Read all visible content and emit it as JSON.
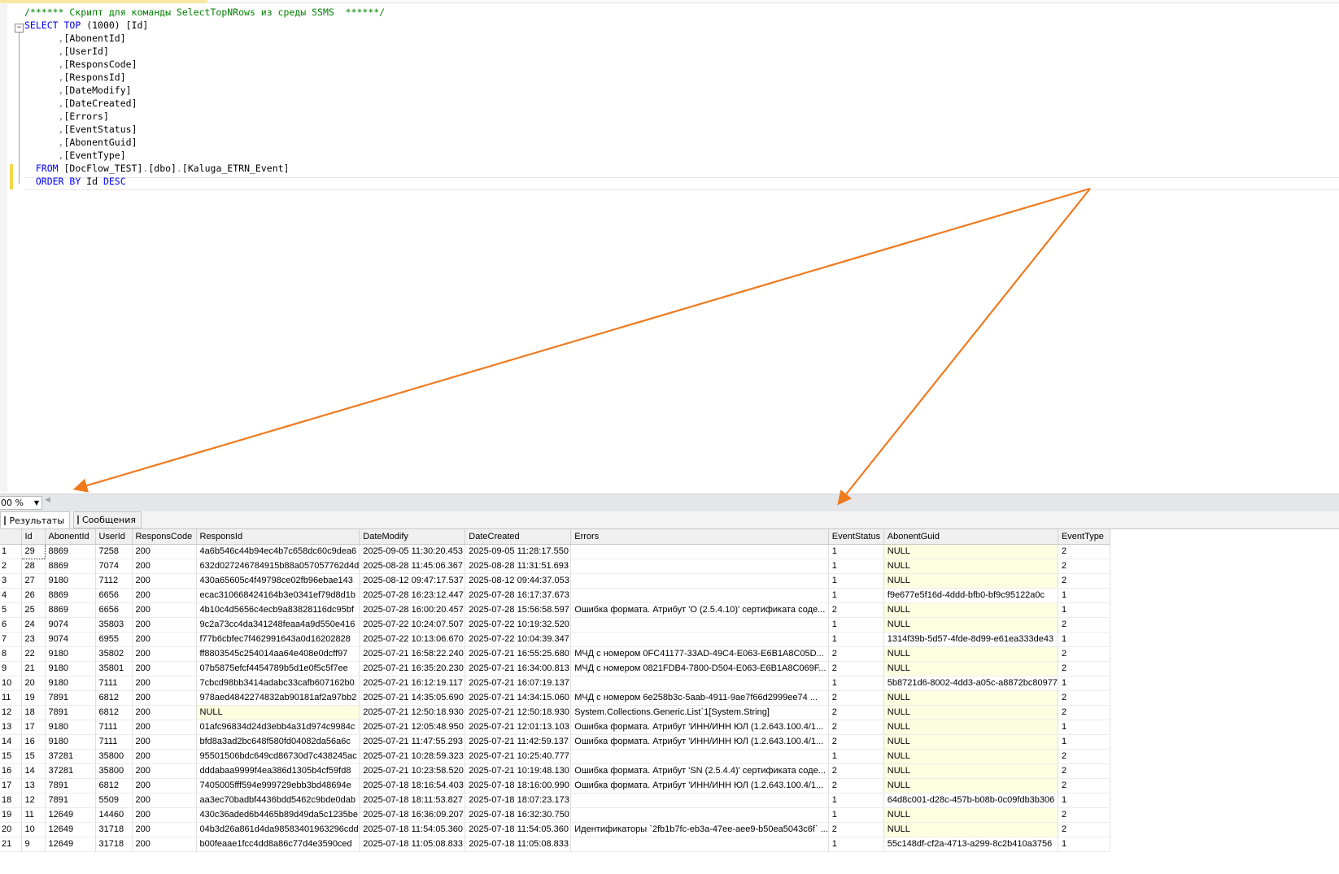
{
  "editor": {
    "lines": [
      [
        {
          "t": "/****** Скрипт для команды SelectTopNRows из среды SSMS  ******/",
          "c": "cm"
        }
      ],
      [
        {
          "t": "SELECT",
          "c": "kw"
        },
        {
          "t": " "
        },
        {
          "t": "TOP",
          "c": "kw"
        },
        {
          "t": " (1000) [Id]"
        }
      ],
      [
        {
          "t": "      "
        },
        {
          "t": ",",
          "c": "gr"
        },
        {
          "t": "[AbonentId]"
        }
      ],
      [
        {
          "t": "      "
        },
        {
          "t": ",",
          "c": "gr"
        },
        {
          "t": "[UserId]"
        }
      ],
      [
        {
          "t": "      "
        },
        {
          "t": ",",
          "c": "gr"
        },
        {
          "t": "[ResponsCode]"
        }
      ],
      [
        {
          "t": "      "
        },
        {
          "t": ",",
          "c": "gr"
        },
        {
          "t": "[ResponsId]"
        }
      ],
      [
        {
          "t": "      "
        },
        {
          "t": ",",
          "c": "gr"
        },
        {
          "t": "[DateModify]"
        }
      ],
      [
        {
          "t": "      "
        },
        {
          "t": ",",
          "c": "gr"
        },
        {
          "t": "[DateCreated]"
        }
      ],
      [
        {
          "t": "      "
        },
        {
          "t": ",",
          "c": "gr"
        },
        {
          "t": "[Errors]"
        }
      ],
      [
        {
          "t": "      "
        },
        {
          "t": ",",
          "c": "gr"
        },
        {
          "t": "[EventStatus]"
        }
      ],
      [
        {
          "t": "      "
        },
        {
          "t": ",",
          "c": "gr"
        },
        {
          "t": "[AbonentGuid]"
        }
      ],
      [
        {
          "t": "      "
        },
        {
          "t": ",",
          "c": "gr"
        },
        {
          "t": "[EventType]"
        }
      ],
      [
        {
          "t": "  "
        },
        {
          "t": "FROM",
          "c": "kw"
        },
        {
          "t": " [DocFlow_TEST]"
        },
        {
          "t": ".",
          "c": "gr"
        },
        {
          "t": "[dbo]"
        },
        {
          "t": ".",
          "c": "gr"
        },
        {
          "t": "[Kaluga_ETRN_Event]"
        }
      ],
      [
        {
          "t": "  "
        },
        {
          "t": "ORDER BY",
          "c": "kw"
        },
        {
          "t": " Id "
        },
        {
          "t": "DESC",
          "c": "kw"
        }
      ]
    ],
    "fold_symbol": "−"
  },
  "zoom": {
    "value": "00 %",
    "dropdown_icon": "▼",
    "scroll_left_icon": "◀"
  },
  "tabs": {
    "results": "Результаты",
    "messages": "Сообщения"
  },
  "grid": {
    "columns": [
      "Id",
      "AbonentId",
      "UserId",
      "ResponsCode",
      "ResponsId",
      "DateModify",
      "DateCreated",
      "Errors",
      "EventStatus",
      "AbonentGuid",
      "EventType"
    ],
    "rows": [
      [
        "1",
        "29",
        "8869",
        "7258",
        "200",
        "4a6b546c44b94ec4b7c658dc60c9dea6",
        "2025-09-05 11:30:20.453",
        "2025-09-05 11:28:17.550",
        "",
        "1",
        "NULL",
        "2"
      ],
      [
        "2",
        "28",
        "8869",
        "7074",
        "200",
        "632d027246784915b88a057057762d4d",
        "2025-08-28 11:45:06.367",
        "2025-08-28 11:31:51.693",
        "",
        "1",
        "NULL",
        "2"
      ],
      [
        "3",
        "27",
        "9180",
        "7112",
        "200",
        "430a65605c4f49798ce02fb96ebae143",
        "2025-08-12 09:47:17.537",
        "2025-08-12 09:44:37.053",
        "",
        "1",
        "NULL",
        "2"
      ],
      [
        "4",
        "26",
        "8869",
        "6656",
        "200",
        "ecac310668424164b3e0341ef79d8d1b",
        "2025-07-28 16:23:12.447",
        "2025-07-28 16:17:37.673",
        "",
        "1",
        "f9e677e5f16d-4ddd-bfb0-bf9c95122a0c",
        "1"
      ],
      [
        "5",
        "25",
        "8869",
        "6656",
        "200",
        "4b10c4d5656c4ecb9a83828116dc95bf",
        "2025-07-28 16:00:20.457",
        "2025-07-28 15:56:58.597",
        "Ошибка формата. Атрибут 'O (2.5.4.10)' сертификата соде...",
        "2",
        "NULL",
        "1"
      ],
      [
        "6",
        "24",
        "9074",
        "35803",
        "200",
        "9c2a73cc4da341248feaa4a9d550e416",
        "2025-07-22 10:24:07.507",
        "2025-07-22 10:19:32.520",
        "",
        "1",
        "NULL",
        "2"
      ],
      [
        "7",
        "23",
        "9074",
        "6955",
        "200",
        "f77b6cbfec7f462991643a0d16202828",
        "2025-07-22 10:13:06.670",
        "2025-07-22 10:04:39.347",
        "",
        "1",
        "1314f39b-5d57-4fde-8d99-e61ea333de43",
        "1"
      ],
      [
        "8",
        "22",
        "9180",
        "35802",
        "200",
        "ff8803545c254014aa64e408e0dcff97",
        "2025-07-21 16:58:22.240",
        "2025-07-21 16:55:25.680",
        "МЧД с номером 0FC41177-33AD-49C4-E063-E6B1A8C05D...",
        "2",
        "NULL",
        "2"
      ],
      [
        "9",
        "21",
        "9180",
        "35801",
        "200",
        "07b5875efcf4454789b5d1e0f5c5f7ee",
        "2025-07-21 16:35:20.230",
        "2025-07-21 16:34:00.813",
        "МЧД с номером 0821FDB4-7800-D504-E063-E6B1A8C069F...",
        "2",
        "NULL",
        "2"
      ],
      [
        "10",
        "20",
        "9180",
        "7111",
        "200",
        "7cbcd98bb3414adabc33cafb607162b0",
        "2025-07-21 16:12:19.117",
        "2025-07-21 16:07:19.137",
        "",
        "1",
        "5b8721d6-8002-4dd3-a05c-a8872bc80977",
        "1"
      ],
      [
        "11",
        "19",
        "7891",
        "6812",
        "200",
        "978aed4842274832ab90181af2a97bb2",
        "2025-07-21 14:35:05.690",
        "2025-07-21 14:34:15.060",
        "МЧД с номером 6e258b3c-5aab-4911-9ae7f66d2999ee74 ...",
        "2",
        "NULL",
        "2"
      ],
      [
        "12",
        "18",
        "7891",
        "6812",
        "200",
        "NULL",
        "2025-07-21 12:50:18.930",
        "2025-07-21 12:50:18.930",
        "System.Collections.Generic.List`1[System.String]",
        "2",
        "NULL",
        "2"
      ],
      [
        "13",
        "17",
        "9180",
        "7111",
        "200",
        "01afc96834d24d3ebb4a31d974c9984c",
        "2025-07-21 12:05:48.950",
        "2025-07-21 12:01:13.103",
        "Ошибка формата. Атрибут 'ИНН/ИНН ЮЛ (1.2.643.100.4/1...",
        "2",
        "NULL",
        "1"
      ],
      [
        "14",
        "16",
        "9180",
        "7111",
        "200",
        "bfd8a3ad2bc648f580fd04082da56a6c",
        "2025-07-21 11:47:55.293",
        "2025-07-21 11:42:59.137",
        "Ошибка формата. Атрибут 'ИНН/ИНН ЮЛ (1.2.643.100.4/1...",
        "2",
        "NULL",
        "1"
      ],
      [
        "15",
        "15",
        "37281",
        "35800",
        "200",
        "95501506bdc649cd86730d7c438245ac",
        "2025-07-21 10:28:59.323",
        "2025-07-21 10:25:40.777",
        "",
        "1",
        "NULL",
        "2"
      ],
      [
        "16",
        "14",
        "37281",
        "35800",
        "200",
        "dddabaa9999f4ea386d1305b4cf59fd8",
        "2025-07-21 10:23:58.520",
        "2025-07-21 10:19:48.130",
        "Ошибка формата. Атрибут 'SN (2.5.4.4)' сертификата соде...",
        "2",
        "NULL",
        "2"
      ],
      [
        "17",
        "13",
        "7891",
        "6812",
        "200",
        "7405005fff594e999729ebb3bd48694e",
        "2025-07-18 18:16:54.403",
        "2025-07-18 18:16:00.990",
        "Ошибка формата. Атрибут 'ИНН/ИНН ЮЛ (1.2.643.100.4/1...",
        "2",
        "NULL",
        "2"
      ],
      [
        "18",
        "12",
        "7891",
        "5509",
        "200",
        "aa3ec70badbf4436bdd5462c9bde0dab",
        "2025-07-18 18:11:53.827",
        "2025-07-18 18:07:23.173",
        "",
        "1",
        "64d8c001-d28c-457b-b08b-0c09fdb3b306",
        "1"
      ],
      [
        "19",
        "11",
        "12649",
        "14460",
        "200",
        "430c36aded6b4465b89d49da5c1235be",
        "2025-07-18 16:36:09.207",
        "2025-07-18 16:32:30.750",
        "",
        "1",
        "NULL",
        "2"
      ],
      [
        "20",
        "10",
        "12649",
        "31718",
        "200",
        "04b3d26a861d4da98583401963296cdd",
        "2025-07-18 11:54:05.360",
        "2025-07-18 11:54:05.360",
        "Идентификаторы `2fb1b7fc-eb3a-47ee-aee9-b50ea5043c6f` ...",
        "2",
        "NULL",
        "2"
      ],
      [
        "21",
        "9",
        "12649",
        "31718",
        "200",
        "b00feaae1fcc4dd8a86c77d4e3590ced",
        "2025-07-18 11:05:08.833",
        "2025-07-18 11:05:08.833",
        "",
        "1",
        "55c148df-cf2a-4713-a299-8c2b410a3756",
        "1"
      ]
    ]
  },
  "colors": {
    "arrow": "#f07a1e",
    "null_cell": "#fdfde0",
    "keyword": "#0000ff",
    "comment": "#008000"
  }
}
